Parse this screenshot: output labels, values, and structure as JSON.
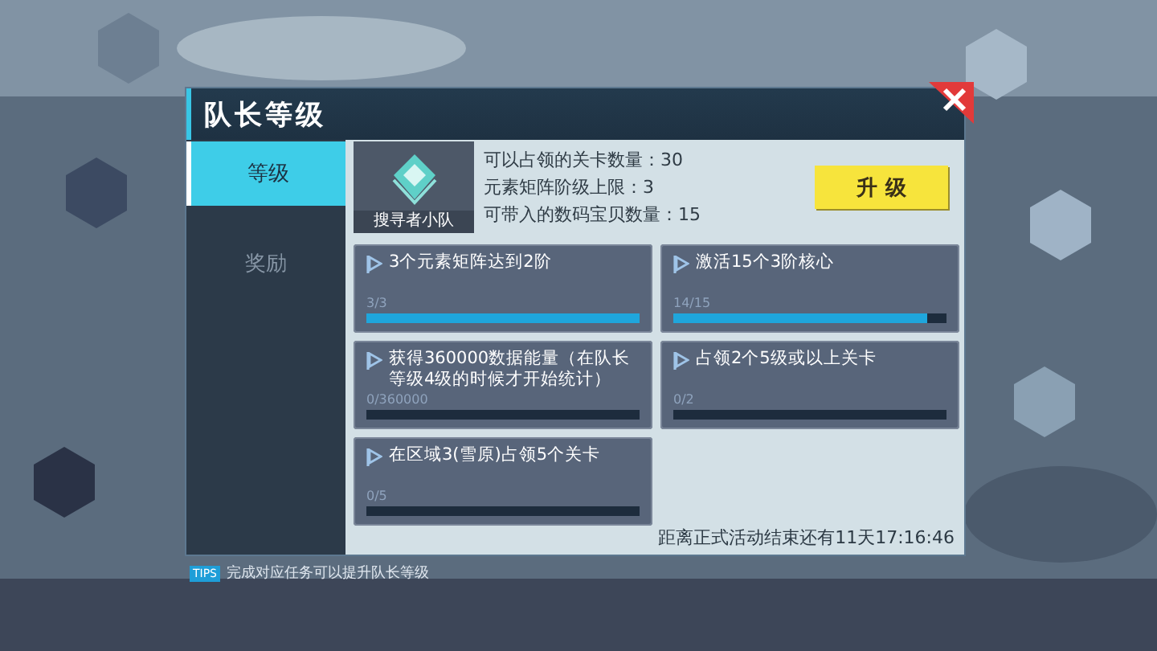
{
  "title": "队长等级",
  "tabs": [
    {
      "label": "等级",
      "selected": true
    },
    {
      "label": "奖励",
      "selected": false
    }
  ],
  "rank": {
    "name": "搜寻者小队"
  },
  "stats": [
    "可以占领的关卡数量：30",
    "元素矩阵阶级上限：3",
    "可带入的数码宝贝数量：15"
  ],
  "upgrade_button": "升 级",
  "tasks": [
    {
      "text": "3个元素矩阵达到2阶",
      "progress": "3/3",
      "level": 1
    },
    {
      "text": "激活15个3阶核心",
      "progress": "14/15",
      "level": 0.93
    },
    {
      "text": "获得360000数据能量（在队长等级4级的时候才开始统计）",
      "progress": "0/360000",
      "level": 0
    },
    {
      "text": "占领2个5级或以上关卡",
      "progress": "0/2",
      "level": 0
    },
    {
      "text": "在区域3(雪原)占领5个关卡",
      "progress": "0/5",
      "level": 0
    }
  ],
  "countdown": "距离正式活动结束还有11天17:16:46",
  "tips": {
    "badge": "TIPS",
    "text": "完成对应任务可以提升队长等级"
  }
}
